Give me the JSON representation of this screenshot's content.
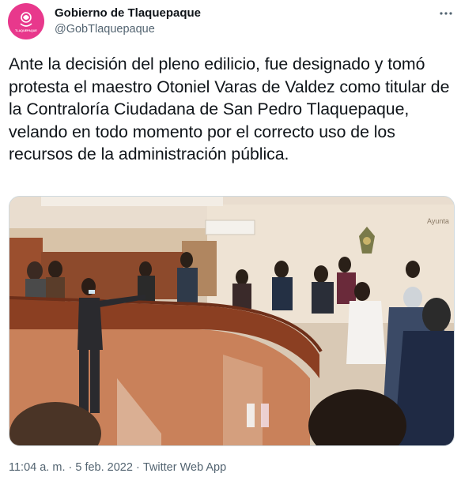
{
  "account": {
    "display_name": "Gobierno de Tlaquepaque",
    "handle": "@GobTlaquepaque",
    "avatar_text": "TLAQUEPAQUE",
    "brand_color": "#e8388c",
    "more_icon": "more-horizontal-icon"
  },
  "tweet": {
    "text": "Ante la decisión del pleno edilicio, fue designado y tomó protesta el maestro Otoniel Varas de Valdez como titular de la Contraloría Ciudadana de San Pedro Tlaquepaque, velando en todo momento por el correcto uso de los recursos de la administración pública.",
    "time": "11:04 a. m.",
    "separator": "·",
    "date": "5 feb. 2022",
    "source": "Twitter Web App"
  },
  "media": {
    "wall_sign": "Ayunta"
  },
  "colors": {
    "text": "#0f1419",
    "secondary": "#536471",
    "border": "#cfd9de"
  }
}
